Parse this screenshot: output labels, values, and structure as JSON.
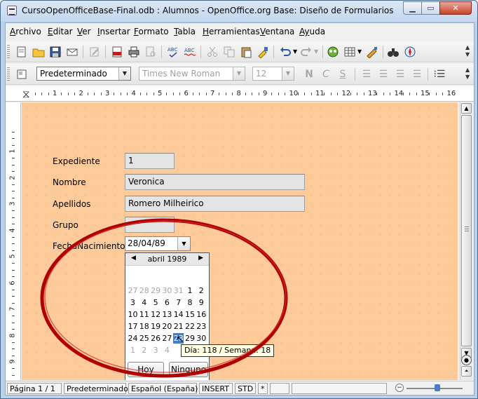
{
  "window": {
    "title": "CursoOpenOfficeBase-Final.odb : Alumnos - OpenOffice.org Base: Diseño de Formularios",
    "min": "▁",
    "max": "▭",
    "close": "✕"
  },
  "menu": [
    {
      "ul": "A",
      "rest": "rchivo"
    },
    {
      "ul": "E",
      "rest": "ditar"
    },
    {
      "ul": "V",
      "rest": "er"
    },
    {
      "ul": "I",
      "rest": "nsertar"
    },
    {
      "ul": "F",
      "rest": "ormato"
    },
    {
      "ul": "T",
      "rest": "abla"
    },
    {
      "ul": "H",
      "rest": "erramientas"
    },
    {
      "ul": "V",
      "rest": "entana"
    },
    {
      "ul": "Ay",
      "rest": "uda"
    }
  ],
  "format_toolbar": {
    "style": "Predeterminado",
    "font": "Times New Roman",
    "size": "12"
  },
  "ruler": {
    "h_marks": [
      "1",
      "2",
      "3",
      "4",
      "5",
      "6",
      "7",
      "8",
      "9",
      "10",
      "11",
      "12",
      "13",
      "14",
      "15",
      "16"
    ],
    "v_marks": [
      "1",
      "2",
      "3",
      "4",
      "5",
      "6",
      "7",
      "8",
      "9",
      "10"
    ]
  },
  "form": {
    "expediente": {
      "label": "Expediente",
      "value": "1"
    },
    "nombre": {
      "label": "Nombre",
      "value": "Veronica"
    },
    "apellidos": {
      "label": "Apellidos",
      "value": "Romero Milheirico"
    },
    "grupo": {
      "label": "Grupo",
      "value": ""
    },
    "fecha": {
      "label": "FechaNacimiento",
      "value": "28/04/89"
    }
  },
  "calendar": {
    "month": "abril 1989",
    "weeks": [
      [
        {
          "d": "27",
          "o": true
        },
        {
          "d": "28",
          "o": true
        },
        {
          "d": "29",
          "o": true
        },
        {
          "d": "30",
          "o": true
        },
        {
          "d": "31",
          "o": true
        },
        {
          "d": "1"
        },
        {
          "d": "2"
        }
      ],
      [
        {
          "d": "3"
        },
        {
          "d": "4"
        },
        {
          "d": "5"
        },
        {
          "d": "6"
        },
        {
          "d": "7"
        },
        {
          "d": "8"
        },
        {
          "d": "9"
        }
      ],
      [
        {
          "d": "10"
        },
        {
          "d": "11"
        },
        {
          "d": "12"
        },
        {
          "d": "13"
        },
        {
          "d": "14"
        },
        {
          "d": "15"
        },
        {
          "d": "16"
        }
      ],
      [
        {
          "d": "17"
        },
        {
          "d": "18"
        },
        {
          "d": "19"
        },
        {
          "d": "20"
        },
        {
          "d": "21"
        },
        {
          "d": "22"
        },
        {
          "d": "23"
        }
      ],
      [
        {
          "d": "24"
        },
        {
          "d": "25"
        },
        {
          "d": "26"
        },
        {
          "d": "27"
        },
        {
          "d": "28",
          "s": true
        },
        {
          "d": "29"
        },
        {
          "d": "30"
        }
      ],
      [
        {
          "d": "1",
          "o": true
        },
        {
          "d": "2",
          "o": true
        },
        {
          "d": "3",
          "o": true
        },
        {
          "d": "4",
          "o": true
        },
        {
          "d": "",
          "o": true
        },
        {
          "d": "",
          "o": true
        },
        {
          "d": "",
          "o": true
        }
      ]
    ],
    "today_button": "Hoy",
    "none_button": "Ninguno",
    "tooltip": "Día: 118 / Semana: 18"
  },
  "statusbar": {
    "page": "Página 1 / 1",
    "style": "Predeterminado",
    "language": "Español (España)",
    "insert": "INSERT",
    "selection": "STD",
    "modified": "*"
  },
  "colors": {
    "page_bg": "#fdca9a",
    "annotation": "#b00000",
    "selected_day": "#3c7fd6"
  }
}
